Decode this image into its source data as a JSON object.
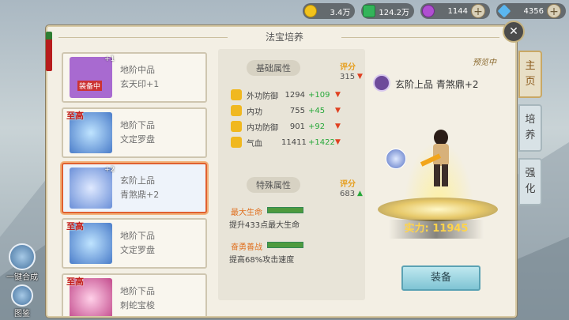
{
  "currency": [
    {
      "icon": "gold-coin-icon",
      "value": "3.4万",
      "color": "#f2c21b"
    },
    {
      "icon": "jade-icon",
      "value": "124.2万",
      "color": "#33b45a"
    },
    {
      "icon": "purple-orb-icon",
      "value": "1144",
      "color": "#b04fd1"
    },
    {
      "icon": "diamond-icon",
      "value": "4356",
      "color": "#5ab6f0"
    }
  ],
  "panel": {
    "title": "法宝培养"
  },
  "list": [
    {
      "grade_badge": "",
      "level": "+1",
      "line1": "地阶中品",
      "line2": "玄天印+1",
      "equipped_tag": "装备中",
      "thumb_color": "#a86ad0"
    },
    {
      "grade_badge": "至高",
      "level": "",
      "line1": "地阶下品",
      "line2": "文定罗盘",
      "equipped_tag": "",
      "thumb_color": "#4a7cc9"
    },
    {
      "grade_badge": "",
      "level": "+2",
      "line1": "玄阶上品",
      "line2": "青煞鼎+2",
      "equipped_tag": "",
      "thumb_color": "#6a8fd8"
    },
    {
      "grade_badge": "至高",
      "level": "",
      "line1": "地阶下品",
      "line2": "文定罗盘",
      "equipped_tag": "",
      "thumb_color": "#4a7cc9"
    },
    {
      "grade_badge": "至高",
      "level": "",
      "line1": "地阶下品",
      "line2": "刺蛇宝梭",
      "equipped_tag": "",
      "thumb_color": "#c24a8c"
    }
  ],
  "basic": {
    "title": "基础属性",
    "score_label": "评分",
    "score_value": "315",
    "rows": [
      {
        "name": "外功防御",
        "value": "1294",
        "delta": "+109"
      },
      {
        "name": "内功",
        "value": "755",
        "delta": "+45"
      },
      {
        "name": "内功防御",
        "value": "901",
        "delta": "+92"
      },
      {
        "name": "气血",
        "value": "11411",
        "delta": "+1422"
      }
    ]
  },
  "special": {
    "title": "特殊属性",
    "score_label": "评分",
    "score_value": "683",
    "items": [
      {
        "name": "最大生命",
        "desc": "提升433点最大生命"
      },
      {
        "name": "奋勇善战",
        "desc": "提高68%攻击速度"
      }
    ]
  },
  "preview": {
    "tag": "预览中",
    "treasure_name": "玄阶上品 青煞鼎+2",
    "power_label": "实力:",
    "power_value": "11945",
    "equip_button": "装备"
  },
  "tabs": [
    {
      "label": "主页"
    },
    {
      "label": "培养"
    },
    {
      "label": "强化"
    }
  ],
  "side_buttons": [
    {
      "label": "一键合成"
    },
    {
      "label": "图鉴"
    }
  ]
}
